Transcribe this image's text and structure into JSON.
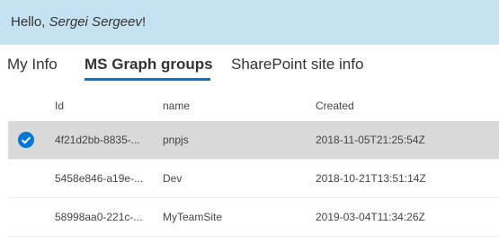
{
  "banner": {
    "greeting": "Hello, ",
    "user_name": "Sergei Sergeev",
    "suffix": "!"
  },
  "tabs": [
    {
      "label": "My Info",
      "selected": false
    },
    {
      "label": "MS Graph groups",
      "selected": true
    },
    {
      "label": "SharePoint site info",
      "selected": false
    }
  ],
  "table": {
    "columns": [
      "Id",
      "name",
      "Created"
    ],
    "rows": [
      {
        "id": "4f21d2bb-8835-...",
        "name": "pnpjs",
        "created": "2018-11-05T21:25:54Z",
        "selected": true
      },
      {
        "id": "5458e846-a19e-...",
        "name": "Dev",
        "created": "2018-10-21T13:51:14Z",
        "selected": false
      },
      {
        "id": "58998aa0-221c-...",
        "name": "MyTeamSite",
        "created": "2019-03-04T11:34:26Z",
        "selected": false
      }
    ]
  },
  "colors": {
    "banner_bg": "#c5e2f3",
    "accent": "#0078d4",
    "selected_row_bg": "#d9d9d9"
  }
}
